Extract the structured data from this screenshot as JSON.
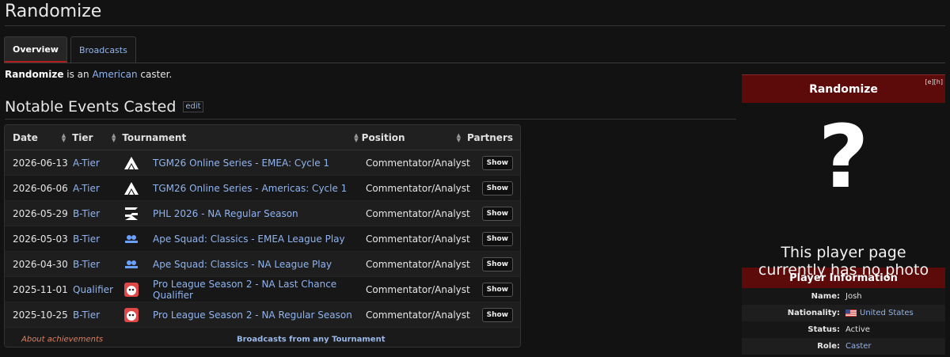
{
  "page": {
    "title": "Randomize"
  },
  "tabs": [
    {
      "label": "Overview",
      "active": true
    },
    {
      "label": "Broadcasts",
      "active": false
    }
  ],
  "intro": {
    "name": "Randomize",
    "text_mid": " is an ",
    "nationality_link": "American",
    "text_end": " caster."
  },
  "section": {
    "title": "Notable Events Casted",
    "edit_label": "edit"
  },
  "table": {
    "headers": {
      "date": "Date",
      "tier": "Tier",
      "tournament": "Tournament",
      "position": "Position",
      "partners": "Partners"
    },
    "rows": [
      {
        "date": "2026-06-13",
        "tier": "A-Tier",
        "tournament": "TGM26 Online Series - EMEA: Cycle 1",
        "icon": "tgm-triangle-icon",
        "position": "Commentator/Analyst",
        "partners": "Show"
      },
      {
        "date": "2026-06-06",
        "tier": "A-Tier",
        "tournament": "TGM26 Online Series - Americas: Cycle 1",
        "icon": "tgm-triangle-icon",
        "position": "Commentator/Analyst",
        "partners": "Show"
      },
      {
        "date": "2026-05-29",
        "tier": "B-Tier",
        "tournament": "PHL 2026 - NA Regular Season",
        "icon": "phl-logo-icon",
        "position": "Commentator/Analyst",
        "partners": "Show"
      },
      {
        "date": "2026-05-03",
        "tier": "B-Tier",
        "tournament": "Ape Squad: Classics - EMEA League Play",
        "icon": "ape-squad-classics-icon",
        "position": "Commentator/Analyst",
        "partners": "Show"
      },
      {
        "date": "2026-04-30",
        "tier": "B-Tier",
        "tournament": "Ape Squad: Classics - NA League Play",
        "icon": "ape-squad-classics-icon",
        "position": "Commentator/Analyst",
        "partners": "Show"
      },
      {
        "date": "2025-11-01",
        "tier": "Qualifier",
        "tournament": "Pro League Season 2 - NA Last Chance Qualifier",
        "icon": "pro-league-icon",
        "position": "Commentator/Analyst",
        "partners": "Show"
      },
      {
        "date": "2025-10-25",
        "tier": "B-Tier",
        "tournament": "Pro League Season 2 - NA Regular Season",
        "icon": "pro-league-icon",
        "position": "Commentator/Analyst",
        "partners": "Show"
      }
    ],
    "footer": {
      "about": "About achievements",
      "broadcasts": "Broadcasts from any Tournament"
    }
  },
  "infobox": {
    "title": "Randomize",
    "edit_links": "[e][h]",
    "placeholder_glyph": "?",
    "no_photo_line1": "This player page",
    "no_photo_line2": "currently has no photo",
    "section_title": "Player Information",
    "fields": [
      {
        "label": "Name:",
        "value": "Josh",
        "link": false
      },
      {
        "label": "Nationality:",
        "value": "United States",
        "link": true,
        "flag": true
      },
      {
        "label": "Status:",
        "value": "Active",
        "link": false
      },
      {
        "label": "Role:",
        "value": "Caster",
        "link": true
      }
    ]
  },
  "colors": {
    "accent_red": "#5d0a0a",
    "link": "#8fb4f0",
    "tab_active_border": "#b01f1f"
  }
}
